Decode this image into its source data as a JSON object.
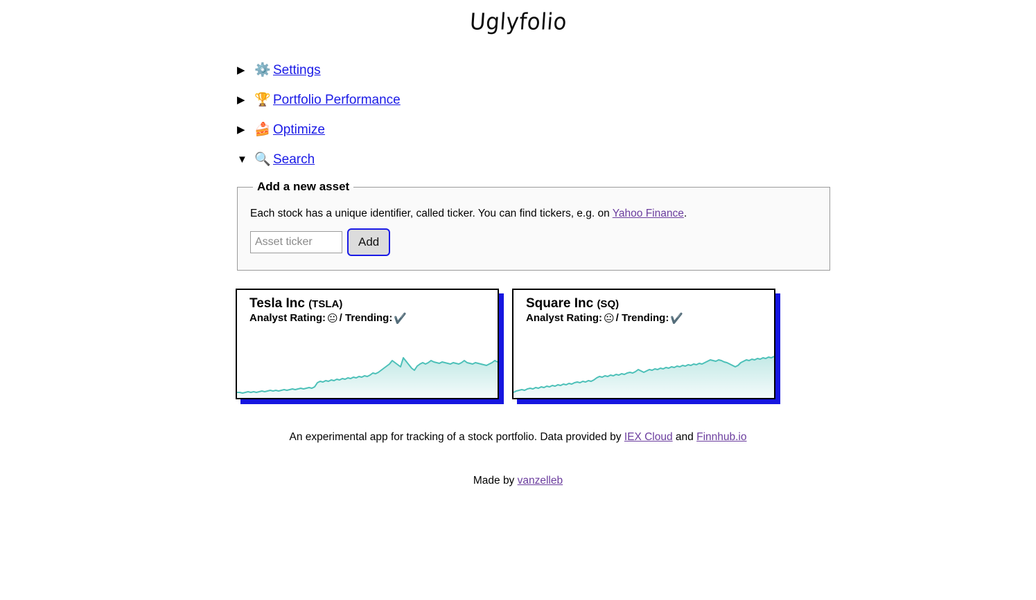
{
  "app": {
    "logo_text": "Uglyfolio"
  },
  "nav": {
    "items": [
      {
        "marker": "▶",
        "icon": "⚙️",
        "icon_name": "gear-icon",
        "label": "Settings",
        "expanded": false
      },
      {
        "marker": "▶",
        "icon": "🏆",
        "icon_name": "trophy-icon",
        "label": "Portfolio Performance",
        "expanded": false
      },
      {
        "marker": "▶",
        "icon": "🍰",
        "icon_name": "cake-slice-icon",
        "label": "Optimize",
        "expanded": false
      },
      {
        "marker": "▼",
        "icon": "🔍",
        "icon_name": "magnifier-icon",
        "label": "Search",
        "expanded": true
      }
    ]
  },
  "search_panel": {
    "legend": "Add a new asset",
    "hint_before": "Each stock has a unique identifier, called ticker. You can find tickers, e.g. on ",
    "hint_link": "Yahoo Finance",
    "hint_after": ".",
    "input_placeholder": "Asset ticker",
    "input_value": "",
    "add_label": "Add"
  },
  "cards": [
    {
      "name": "Tesla Inc",
      "ticker": "(TSLA)",
      "rating_label": "Analyst Rating:",
      "rating_emoji": "😐",
      "trending_label": "/ Trending:",
      "trending_emoji": "✔️",
      "line_color": "#4cc0b8",
      "fill_top": "#c3e9e6",
      "fill_bottom": "#f2fbfa"
    },
    {
      "name": "Square Inc",
      "ticker": "(SQ)",
      "rating_label": "Analyst Rating:",
      "rating_emoji": "😐",
      "trending_label": "/ Trending:",
      "trending_emoji": "✔️",
      "line_color": "#4cc0b8",
      "fill_top": "#c3e9e6",
      "fill_bottom": "#f2fbfa"
    }
  ],
  "chart_data": [
    {
      "type": "area",
      "title": "Tesla Inc (TSLA)",
      "xlabel": "",
      "ylabel": "",
      "grid": false,
      "legend": "none",
      "ylim": [
        0,
        100
      ],
      "values": [
        8,
        8,
        7,
        8,
        9,
        8,
        9,
        8,
        9,
        10,
        9,
        10,
        11,
        10,
        11,
        10,
        11,
        12,
        11,
        12,
        13,
        12,
        13,
        14,
        13,
        14,
        15,
        14,
        16,
        22,
        24,
        23,
        25,
        24,
        26,
        25,
        27,
        26,
        28,
        27,
        29,
        28,
        30,
        29,
        31,
        30,
        32,
        31,
        33,
        35,
        34,
        36,
        38,
        40,
        42,
        44,
        48,
        46,
        44,
        42,
        52,
        48,
        44,
        40,
        38,
        42,
        44,
        46,
        44,
        46,
        48,
        47,
        46,
        45,
        47,
        46,
        45,
        44,
        46,
        45,
        44,
        46,
        48,
        46,
        45,
        44,
        46,
        45,
        44,
        43,
        42,
        44,
        46,
        48,
        46,
        44,
        46,
        48,
        52,
        58,
        62,
        60,
        62,
        64,
        63,
        65,
        64,
        66,
        65,
        67,
        66,
        68,
        67,
        69,
        68,
        70,
        69,
        71,
        70,
        72,
        74,
        78,
        82,
        80,
        84,
        86,
        84,
        88,
        86,
        90,
        88,
        86,
        88,
        90,
        88,
        86,
        84,
        86,
        84,
        82,
        80,
        78,
        76,
        74,
        72,
        70,
        68,
        66,
        68,
        70,
        72,
        70,
        72,
        74,
        72,
        70,
        72,
        74,
        76,
        74,
        76,
        78,
        80,
        78,
        80,
        79,
        78,
        80,
        79,
        81,
        80,
        79,
        78,
        80
      ]
    },
    {
      "type": "area",
      "title": "Square Inc (SQ)",
      "xlabel": "",
      "ylabel": "",
      "grid": false,
      "legend": "none",
      "ylim": [
        0,
        100
      ],
      "values": [
        8,
        9,
        10,
        11,
        10,
        12,
        13,
        12,
        14,
        13,
        15,
        14,
        16,
        15,
        17,
        16,
        18,
        17,
        19,
        18,
        20,
        19,
        21,
        22,
        21,
        23,
        22,
        24,
        23,
        25,
        28,
        30,
        29,
        31,
        30,
        32,
        31,
        33,
        32,
        34,
        33,
        35,
        36,
        35,
        37,
        40,
        38,
        36,
        38,
        40,
        39,
        41,
        40,
        42,
        41,
        43,
        42,
        44,
        43,
        45,
        44,
        46,
        45,
        47,
        46,
        48,
        47,
        49,
        48,
        50,
        52,
        54,
        53,
        52,
        54,
        53,
        51,
        50,
        48,
        46,
        44,
        46,
        50,
        52,
        54,
        53,
        55,
        54,
        56,
        55,
        57,
        56,
        58,
        57,
        59,
        58,
        60,
        59,
        61,
        62,
        64,
        66,
        65,
        64,
        63,
        65,
        64,
        66,
        65,
        67,
        66,
        68,
        70,
        69,
        68,
        67,
        69,
        68,
        67,
        66,
        65,
        64,
        66,
        68,
        70,
        72,
        74,
        76,
        78,
        80,
        82,
        84,
        86,
        88,
        86,
        84,
        80,
        76,
        72,
        70,
        74,
        78,
        82,
        80,
        78,
        74,
        70,
        68,
        70,
        72,
        68,
        66,
        68,
        70,
        72,
        74,
        76,
        80,
        84,
        86,
        88,
        86,
        84,
        82,
        80,
        78,
        80,
        79,
        78,
        80,
        79,
        78,
        77,
        78
      ]
    }
  ],
  "footer": {
    "text_before": "An experimental app for tracking of a stock portfolio. Data provided by ",
    "link1": "IEX Cloud",
    "text_mid": " and ",
    "link2": "Finnhub.io",
    "made_by_prefix": "Made by ",
    "made_by_link": "vanzelleb"
  }
}
